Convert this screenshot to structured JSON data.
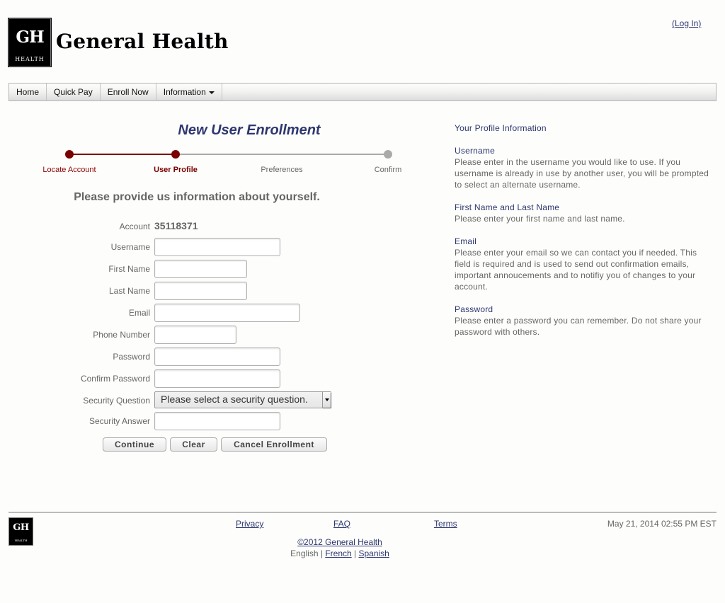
{
  "header": {
    "logo_initials": "GH",
    "logo_subtext": "HEALTH",
    "brand_name": "General Health",
    "login_link": "(Log In)"
  },
  "nav": {
    "items": [
      {
        "label": "Home"
      },
      {
        "label": "Quick Pay"
      },
      {
        "label": "Enroll Now"
      },
      {
        "label": "Information",
        "has_dropdown": true
      }
    ]
  },
  "enrollment": {
    "title": "New User Enrollment",
    "steps": [
      {
        "label": "Locate Account",
        "state": "done"
      },
      {
        "label": "User Profile",
        "state": "current"
      },
      {
        "label": "Preferences",
        "state": "todo"
      },
      {
        "label": "Confirm",
        "state": "todo"
      }
    ],
    "intro": "Please provide us information about yourself."
  },
  "form": {
    "account_label": "Account",
    "account_value": "35118371",
    "fields": {
      "username": {
        "label": "Username",
        "value": ""
      },
      "first_name": {
        "label": "First Name",
        "value": ""
      },
      "last_name": {
        "label": "Last Name",
        "value": ""
      },
      "email": {
        "label": "Email",
        "value": ""
      },
      "phone": {
        "label": "Phone Number",
        "value": ""
      },
      "password": {
        "label": "Password",
        "value": ""
      },
      "confirm_password": {
        "label": "Confirm Password",
        "value": ""
      },
      "security_question": {
        "label": "Security Question",
        "selected": "Please select a security question."
      },
      "security_answer": {
        "label": "Security Answer",
        "value": ""
      }
    },
    "buttons": {
      "continue": "Continue",
      "clear": "Clear",
      "cancel": "Cancel Enrollment"
    }
  },
  "help": {
    "title": "Your Profile Information",
    "sections": [
      {
        "heading": "Username",
        "text": "Please enter in the username you would like to use. If you username is already in use by another user, you will be prompted to select an alternate username."
      },
      {
        "heading": "First Name and Last Name",
        "text": "Please enter your first name and last name."
      },
      {
        "heading": "Email",
        "text": "Please enter your email so we can contact you if needed. This field is required and is used to send out confirmation emails, important annoucements and to notifiy you of changes to your account."
      },
      {
        "heading": "Password",
        "text": "Please enter a password you can remember. Do not share your password with others."
      }
    ]
  },
  "footer": {
    "logo_initials": "GH",
    "logo_subtext": "HEALTH",
    "links": {
      "privacy": "Privacy",
      "faq": "FAQ",
      "terms": "Terms"
    },
    "timestamp": "May 21, 2014 02:55 PM EST",
    "copyright": "©2012 General Health",
    "languages": {
      "current": "English",
      "separator": "|",
      "french": "French",
      "spanish": "Spanish"
    }
  }
}
